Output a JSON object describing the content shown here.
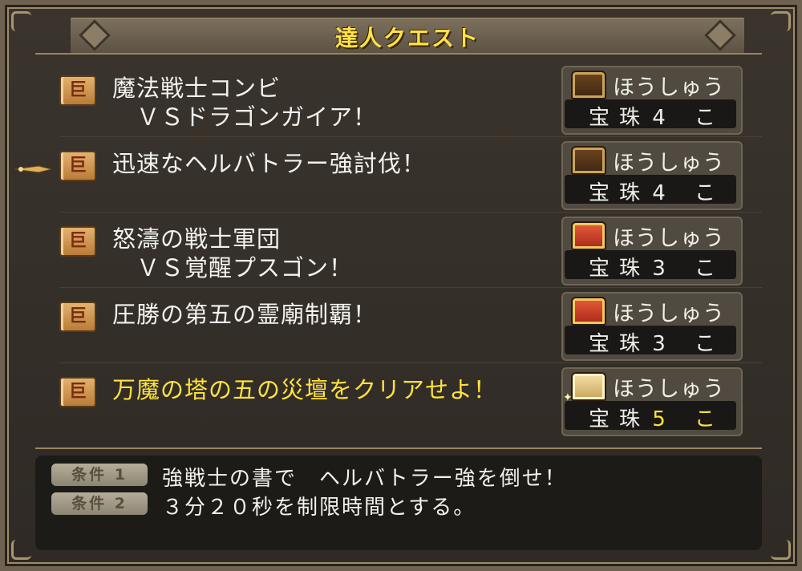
{
  "title": "達人クエスト",
  "quests": [
    {
      "icon": "quest-scroll-icon",
      "name": "魔法戦士コンビ\n　ＶＳドラゴンガイア！",
      "highlighted": false,
      "reward_label": "ほうしゅう",
      "chest": "brown",
      "reward_item": "宝珠",
      "reward_qty": "4 こ"
    },
    {
      "icon": "quest-scroll-icon",
      "name": "迅速なヘルバトラー強討伐！",
      "highlighted": false,
      "reward_label": "ほうしゅう",
      "chest": "brown",
      "reward_item": "宝珠",
      "reward_qty": "4 こ"
    },
    {
      "icon": "quest-scroll-icon",
      "name": "怒濤の戦士軍団\n　ＶＳ覚醒プスゴン！",
      "highlighted": false,
      "reward_label": "ほうしゅう",
      "chest": "red",
      "reward_item": "宝珠",
      "reward_qty": "3 こ"
    },
    {
      "icon": "quest-scroll-icon",
      "name": "圧勝の第五の霊廟制覇！",
      "highlighted": false,
      "reward_label": "ほうしゅう",
      "chest": "red",
      "reward_item": "宝珠",
      "reward_qty": "3 こ"
    },
    {
      "icon": "quest-scroll-icon",
      "name": "万魔の塔の五の災壇をクリアせよ！",
      "highlighted": true,
      "reward_label": "ほうしゅう",
      "chest": "gold",
      "reward_item": "宝珠",
      "reward_qty": "5 こ"
    }
  ],
  "selected_index": 1,
  "conditions": [
    {
      "label": "条件 1",
      "text": "強戦士の書で　ヘルバトラー強を倒せ！"
    },
    {
      "label": "条件 2",
      "text": "３分２０秒を制限時間とする。"
    }
  ],
  "colors": {
    "highlight": "#ffe23a",
    "title": "#ffe14a",
    "text": "#f2f2ee"
  }
}
